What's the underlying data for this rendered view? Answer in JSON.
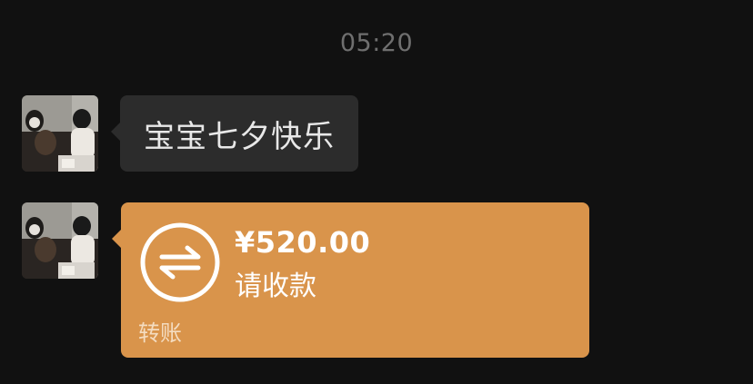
{
  "chat": {
    "timestamp": "05:20"
  },
  "messages": [
    {
      "type": "text",
      "text": "宝宝七夕快乐",
      "avatar_icon": "user-avatar-photo"
    },
    {
      "type": "transfer",
      "amount": "¥520.00",
      "status": "请收款",
      "footer_label": "转账",
      "icon": "transfer-arrows-icon",
      "color": "#d9944b",
      "avatar_icon": "user-avatar-photo"
    }
  ],
  "colors": {
    "background": "#111111",
    "text_bubble": "#2c2c2c",
    "transfer_card": "#d9944b",
    "timestamp": "#6f6f6f"
  }
}
